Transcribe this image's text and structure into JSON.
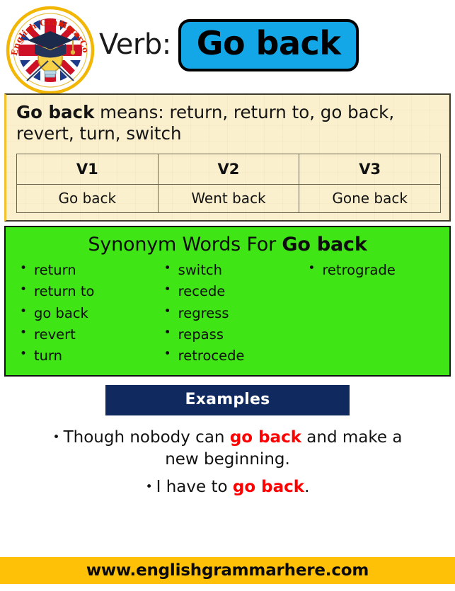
{
  "logo": {
    "arc_text_left": "English Grammar",
    "arc_text_right": "Here.Com",
    "alt": "english-grammar-here-logo",
    "ring_color": "#F2B705",
    "text_color": "#D81E05"
  },
  "header": {
    "verb_label": "Verb:",
    "verb_value": "Go back",
    "verb_box_color": "#13A7E8",
    "verb_box_border": "#000000"
  },
  "meaning": {
    "subject": "Go back",
    "connector": " means: ",
    "definitions": "return, return to, go back, revert, turn, switch",
    "panel_color": "#FBF0CE"
  },
  "verb_table": {
    "headers": [
      "V1",
      "V2",
      "V3"
    ],
    "rows": [
      [
        "Go back",
        "Went back",
        "Gone back"
      ]
    ]
  },
  "synonyms": {
    "title_prefix": "Synonym Words For ",
    "title_subject": "Go back",
    "panel_color": "#3FE514",
    "columns": [
      [
        "return",
        "return to",
        "go back",
        "revert",
        "turn"
      ],
      [
        "switch",
        "recede",
        "regress",
        "repass",
        "retrocede"
      ],
      [
        "retrograde"
      ]
    ]
  },
  "examples": {
    "heading": "Examples",
    "heading_bar_color": "#102A60",
    "highlight_color": "#FF0000",
    "items": [
      {
        "before": "Though nobody can ",
        "highlight": "go back",
        "after": " and make a new beginning."
      },
      {
        "before": "I have to ",
        "highlight": "go back",
        "after": "."
      }
    ]
  },
  "footer": {
    "url": "www.englishgrammarhere.com",
    "bar_color": "#FFC107"
  }
}
